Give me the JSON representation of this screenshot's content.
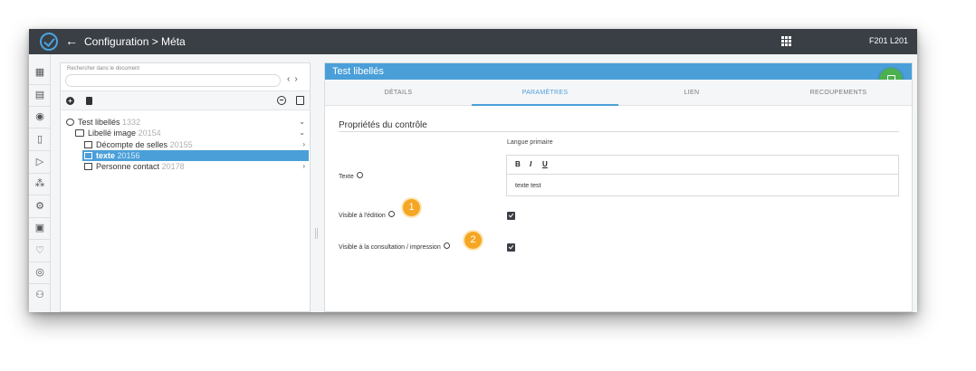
{
  "topbar": {
    "breadcrumb": "Configuration  >  Méta",
    "back_icon": "arrow-left-icon",
    "user_code": "F201 L201"
  },
  "left_panel": {
    "search_label": "Rechercher dans le document",
    "search_value": "",
    "tree": [
      {
        "label": "Test libellés",
        "num": "1332",
        "icon": "status-icon",
        "chevron": "⌄"
      },
      {
        "label": "Libellé image",
        "num": "20154",
        "icon": "folder-icon",
        "chevron": "⌄"
      },
      {
        "label": "Décompte de selles",
        "num": "20155",
        "icon": "checklist-icon",
        "chevron": "›"
      },
      {
        "label": "texte",
        "num": "20156",
        "icon": "text-field-icon",
        "chevron": ""
      },
      {
        "label": "Personne contact",
        "num": "20178",
        "icon": "contact-card-icon",
        "chevron": "›"
      }
    ]
  },
  "right_panel": {
    "title": "Test libellés",
    "tabs": [
      "DÉTAILS",
      "PARAMÈTRES",
      "LIEN",
      "RECOUPEMENTS"
    ],
    "active_tab": "PARAMÈTRES",
    "section_title": "Propriétés du contrôle",
    "language_label": "Langue primaire",
    "texte_label": "Texte",
    "editor": {
      "bold": "B",
      "italic": "I",
      "underline": "U",
      "content": "texte test"
    },
    "visible_edit_label": "Visible à l'édition",
    "visible_consult_label": "Visible à la consultation / impression",
    "visible_edit_checked": true,
    "visible_consult_checked": true
  },
  "callouts": [
    "1",
    "2"
  ],
  "colors": {
    "accent": "#4a9fd8",
    "topbar": "#3a3f45",
    "save": "#4caf50",
    "callout": "#f5a623"
  }
}
